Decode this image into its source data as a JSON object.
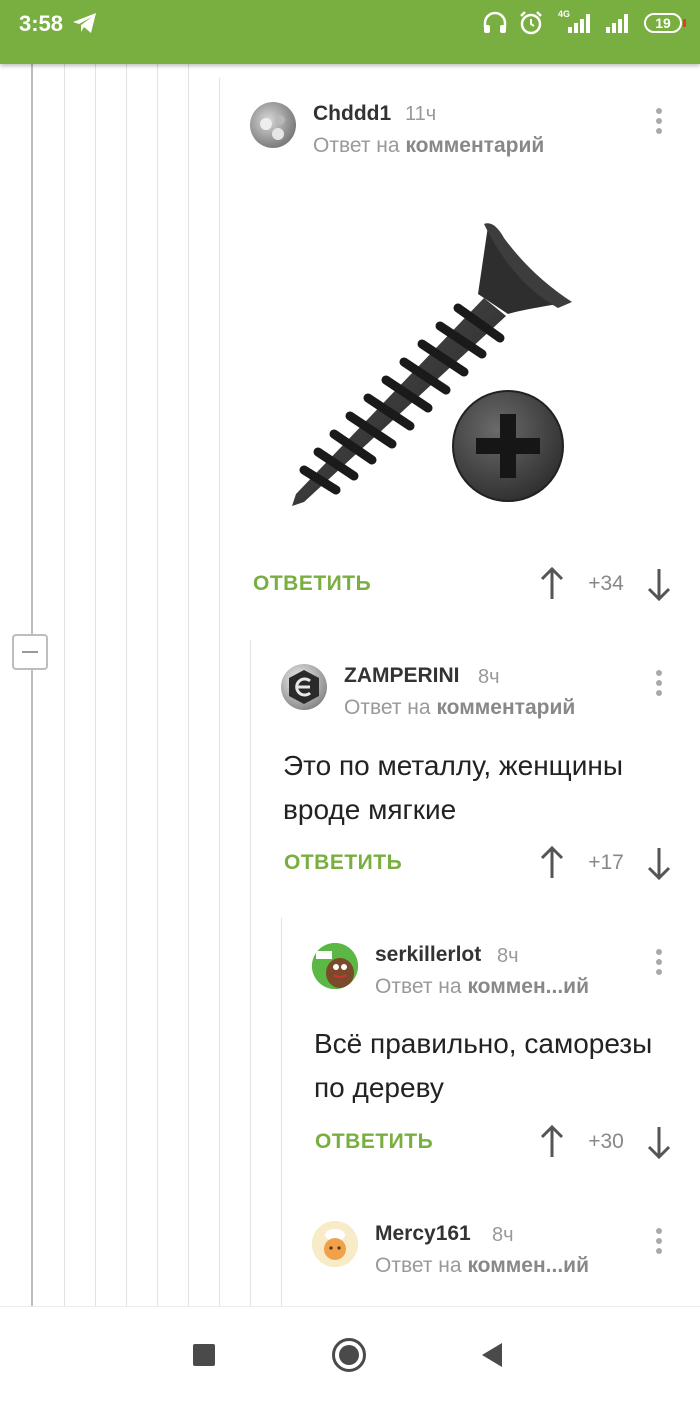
{
  "status_bar": {
    "time": "3:58",
    "network": "4G",
    "battery": "19",
    "icons": [
      "telegram-icon",
      "headphones-icon",
      "alarm-icon",
      "signal-icon",
      "signal-icon",
      "battery-icon"
    ]
  },
  "colors": {
    "accent": "#79ae40",
    "muted": "#999999",
    "text": "#222222"
  },
  "comments": [
    {
      "author": "Chddd1",
      "time": "11ч",
      "reply_prefix": "Ответ на",
      "reply_target": "комментарий",
      "image": "screw-image",
      "reply_label": "ОТВЕТИТЬ",
      "score": "+34"
    },
    {
      "author": "ZAMPERINI",
      "time": "8ч",
      "reply_prefix": "Ответ на",
      "reply_target": "комментарий",
      "text": "Это по металлу, женщины вроде мягкие",
      "reply_label": "ОТВЕТИТЬ",
      "score": "+17"
    },
    {
      "author": "serkillerlot",
      "time": "8ч",
      "reply_prefix": "Ответ на",
      "reply_target": "коммен...ий",
      "text": "Всё правильно, саморезы по дереву",
      "reply_label": "ОТВЕТИТЬ",
      "score": "+30"
    },
    {
      "author": "Mercy161",
      "time": "8ч",
      "reply_prefix": "Ответ на",
      "reply_target": "коммен...ий"
    }
  ],
  "nav": {
    "icons": [
      "recent-apps-icon",
      "home-icon",
      "back-icon"
    ]
  }
}
